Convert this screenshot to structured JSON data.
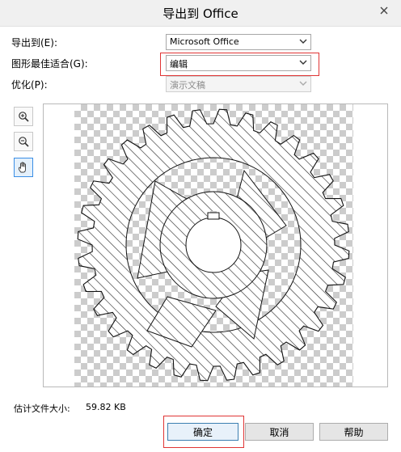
{
  "window": {
    "title": "导出到 Office"
  },
  "form": {
    "export_to": {
      "label": "导出到(E):",
      "value": "Microsoft Office"
    },
    "best_fit": {
      "label": "图形最佳适合(G):",
      "value": "编辑"
    },
    "optimize": {
      "label": "优化(P):",
      "value": "演示文稿"
    }
  },
  "tools": [
    {
      "name": "zoom-in-icon"
    },
    {
      "name": "zoom-out-icon"
    },
    {
      "name": "hand-pan-icon"
    }
  ],
  "filesize": {
    "label": "估计文件大小:",
    "value": "59.82 KB"
  },
  "buttons": {
    "ok": "确定",
    "cancel": "取消",
    "help": "帮助"
  },
  "colors": {
    "highlight": "#e03535",
    "accent": "#3a8ee6"
  }
}
